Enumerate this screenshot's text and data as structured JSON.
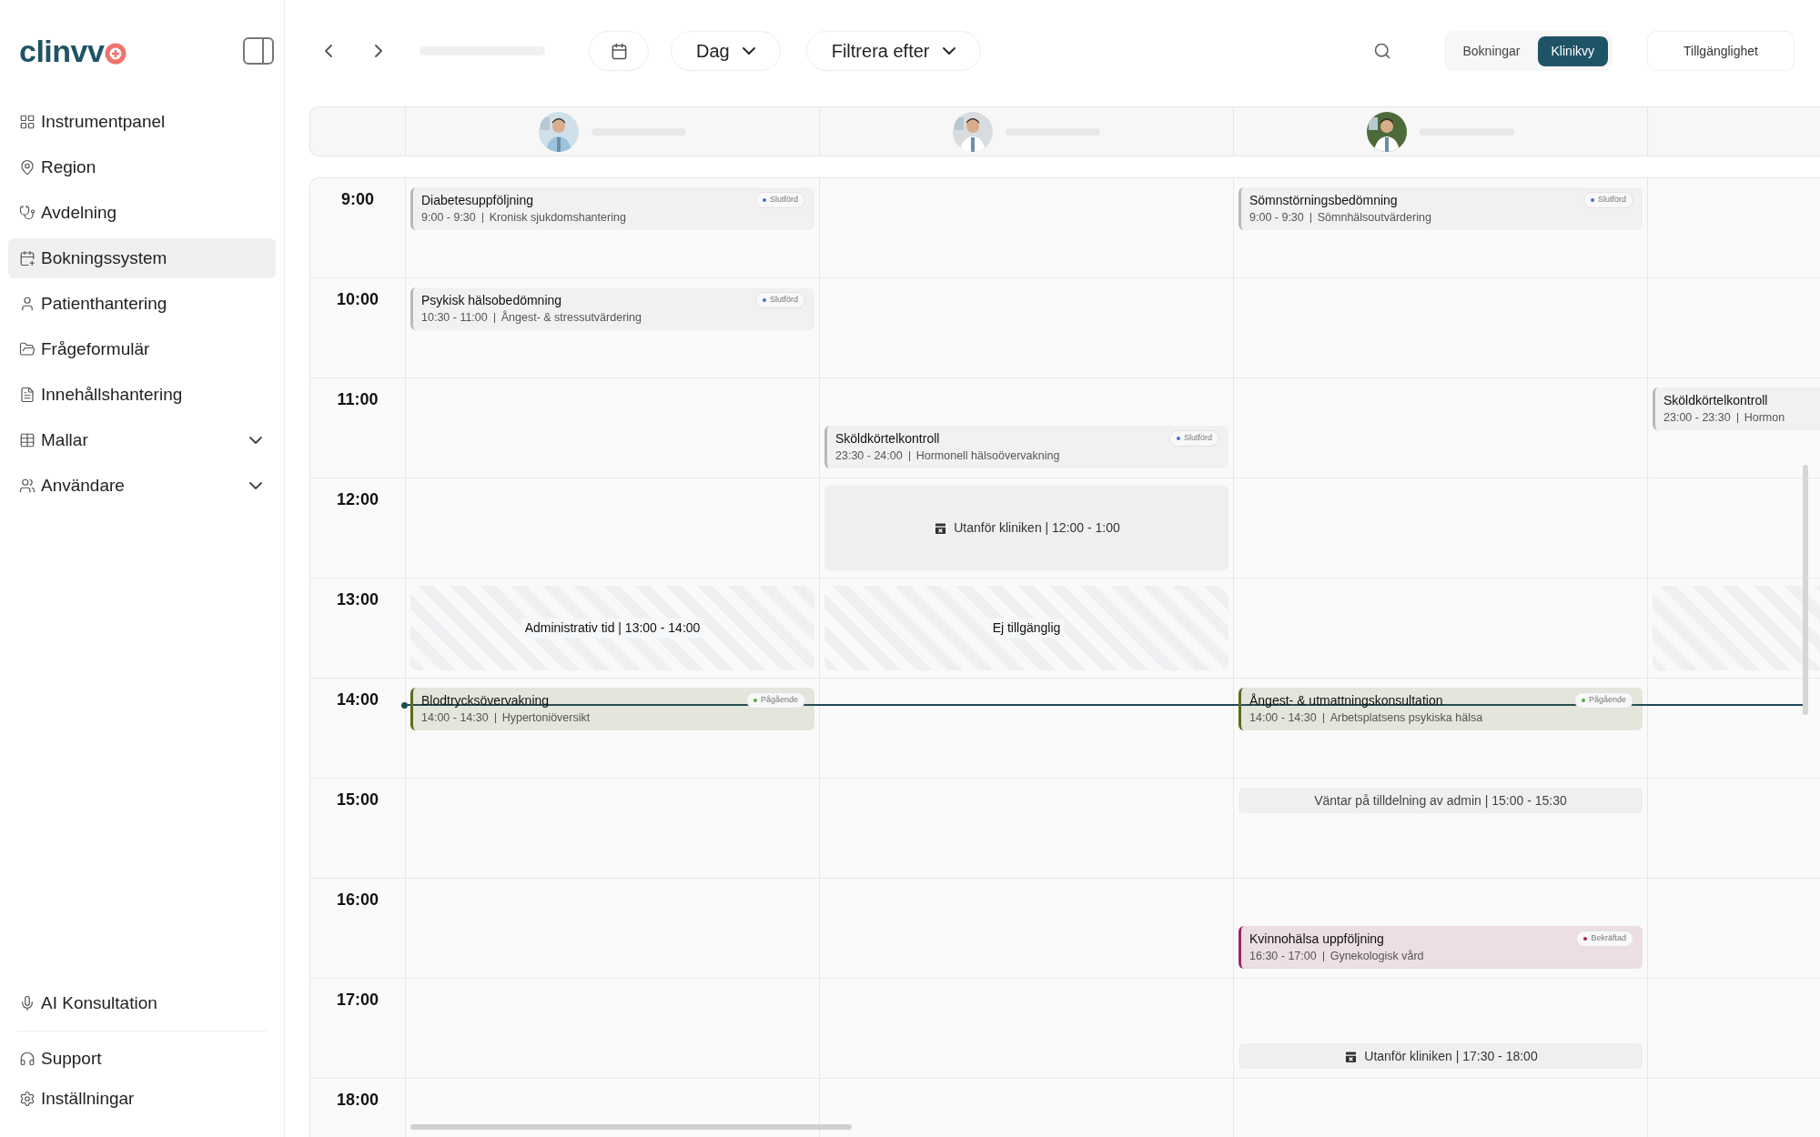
{
  "logo": {
    "text": "clinvv"
  },
  "sidebar": {
    "items": [
      {
        "label": "Instrumentpanel",
        "selected": false,
        "expandable": false
      },
      {
        "label": "Region",
        "selected": false,
        "expandable": false
      },
      {
        "label": "Avdelning",
        "selected": false,
        "expandable": false
      },
      {
        "label": "Bokningssystem",
        "selected": true,
        "expandable": false
      },
      {
        "label": "Patienthantering",
        "selected": false,
        "expandable": false
      },
      {
        "label": "Frågeformulär",
        "selected": false,
        "expandable": false
      },
      {
        "label": "Innehållshantering",
        "selected": false,
        "expandable": false
      },
      {
        "label": "Mallar",
        "selected": false,
        "expandable": true
      },
      {
        "label": "Användare",
        "selected": false,
        "expandable": true
      }
    ],
    "bottom_items": [
      {
        "label": "AI Konsultation"
      },
      {
        "label": "Support"
      },
      {
        "label": "Inställningar"
      }
    ]
  },
  "toolbar": {
    "view": "Dag",
    "filter": "Filtrera efter",
    "toggle": [
      {
        "label": "Bokningar",
        "selected": false
      },
      {
        "label": "Klinikvy",
        "selected": true
      }
    ],
    "availability": "Tillgänglighet"
  },
  "rows": [
    {
      "time": "9:00",
      "current": false,
      "cells": [
        {
          "first_half": {
            "kind": "appointment",
            "color": "#b9b9b9",
            "title": "Diabetesuppföljning",
            "time": "9:00 - 9:30",
            "detail": "Kronisk sjukdomshantering",
            "status": {
              "label": "Slutförd",
              "color": "#4a6fc4"
            }
          }
        },
        null,
        {
          "first_half": {
            "kind": "appointment",
            "color": "#b9b9b9",
            "title": "Sömnstörningsbedömning",
            "time": "9:00 - 9:30",
            "detail": "Sömnhälsoutvärdering",
            "status": {
              "label": "Slutförd",
              "color": "#4a6fc4"
            }
          }
        },
        null
      ]
    },
    {
      "time": "10:00",
      "current": false,
      "cells": [
        {
          "first_half": {
            "kind": "appointment",
            "color": "#b9b9b9",
            "title": "Psykisk hälsobedömning",
            "time": "10:30 - 11:00",
            "detail": "Ångest- & stressutvärdering",
            "status": {
              "label": "Slutförd",
              "color": "#4a6fc4"
            }
          }
        },
        null,
        null,
        null
      ]
    },
    {
      "time": "11:00",
      "current": false,
      "cells": [
        null,
        {
          "second_half": {
            "kind": "appointment",
            "color": "#b9b9b9",
            "title": "Sköldkörtelkontroll",
            "time": "23:30 - 24:00",
            "detail": "Hormonell hälsoövervakning",
            "status": {
              "label": "Slutförd",
              "color": "#4a6fc4"
            }
          }
        },
        null,
        {
          "first_half": {
            "kind": "appointment",
            "color": "#b9b9b9",
            "title": "Sköldkörtelkontroll",
            "time": "23:00 - 23:30",
            "detail": "Hormon"
          }
        }
      ]
    },
    {
      "time": "12:00",
      "current": false,
      "cells": [
        null,
        {
          "full": {
            "kind": "away",
            "label": "Utanför kliniken | 12:00 - 1:00"
          }
        },
        null,
        null
      ]
    },
    {
      "time": "13:00",
      "current": false,
      "cells": [
        {
          "full": {
            "kind": "blocked",
            "label": "Administrativ tid | 13:00 - 14:00"
          }
        },
        {
          "full": {
            "kind": "blocked",
            "label": "Ej tillgänglig"
          }
        },
        null,
        {
          "full": {
            "kind": "blocked"
          }
        }
      ]
    },
    {
      "time": "14:00",
      "current": true,
      "cells": [
        {
          "first_half": {
            "kind": "appointment",
            "color": "#5b6b1e",
            "title": "Blodtrycksövervakning",
            "time": "14:00 - 14:30",
            "detail": "Hypertoniöversikt",
            "status": {
              "label": "Pågående",
              "color": "#4caf3a"
            }
          }
        },
        null,
        {
          "first_half": {
            "kind": "appointment",
            "color": "#5b6b1e",
            "title": "Ångest- & utmattningskonsultation",
            "time": "14:00 - 14:30",
            "detail": "Arbetsplatsens psykiska hälsa",
            "status": {
              "label": "Pågående",
              "color": "#4caf3a"
            }
          }
        },
        null
      ]
    },
    {
      "time": "15:00",
      "current": false,
      "cells": [
        null,
        null,
        {
          "first_half": {
            "kind": "notice",
            "label": "Väntar på tilldelning av admin | 15:00 - 15:30"
          }
        },
        null
      ]
    },
    {
      "time": "16:00",
      "current": false,
      "cells": [
        null,
        null,
        {
          "second_half": {
            "kind": "appointment",
            "color": "#9c2660",
            "title": "Kvinnohälsa uppföljning",
            "time": "16:30 - 17:00",
            "detail": "Gynekologisk vård",
            "status": {
              "label": "Bekräftad",
              "color": "#9c2660"
            }
          }
        },
        null
      ]
    },
    {
      "time": "17:00",
      "current": false,
      "cells": [
        null,
        null,
        {
          "second_half": {
            "kind": "away",
            "label": "Utanför kliniken | 17:30 - 18:00"
          }
        },
        null
      ]
    },
    {
      "time": "18:00",
      "current": false,
      "cells": [
        null,
        null,
        null,
        null
      ]
    }
  ]
}
